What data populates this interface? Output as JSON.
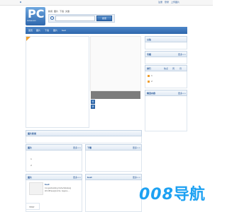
{
  "topbar": {
    "brand_mark": "8",
    "links": [
      "注册",
      "登录",
      "上传图片"
    ]
  },
  "logo": {
    "big": "PC",
    "sub": "PHPGALLERY"
  },
  "search": {
    "tabs": [
      "新闻",
      "图片",
      "下载",
      "文章"
    ],
    "placeholder": "",
    "button": "搜索"
  },
  "nav": {
    "items": [
      "首页",
      "图片",
      "下载",
      "图片",
      "test"
    ]
  },
  "sidebar": {
    "announcement_title": "公告",
    "topics_title": "专题",
    "topics_more": "更多>>",
    "rank_title": "排行",
    "rank_tabs": [
      "热点",
      "周",
      "月"
    ],
    "rank_items": [
      "1",
      "2"
    ],
    "albums_title": "精选内容",
    "albums_more": "更多>>",
    "slider_dots": [
      "1",
      "2"
    ]
  },
  "featured": {
    "title": "图片新闻"
  },
  "panels": {
    "images": {
      "title": "图片",
      "more": "更多>>",
      "items": [
        "1",
        "2"
      ]
    },
    "downloads": {
      "title": "下载",
      "more": "更多>>"
    },
    "article": {
      "title": "图片",
      "more": "更多>>"
    },
    "test": {
      "title": "test",
      "more": "更多>>"
    }
  },
  "article": {
    "title": "test",
    "body": "Congratulating facts/details/g WordPress/Joomla. begins..."
  },
  "footer": {
    "text": "TEST"
  },
  "overlay": {
    "digits": "008",
    "cn": "导航"
  },
  "colors": {
    "accent": "#2e67ad",
    "nav_bg": "#3b72b8",
    "header_bg": "#e1eaf4",
    "orange": "#f0a030",
    "grey_bar": "#7c7c7c"
  }
}
